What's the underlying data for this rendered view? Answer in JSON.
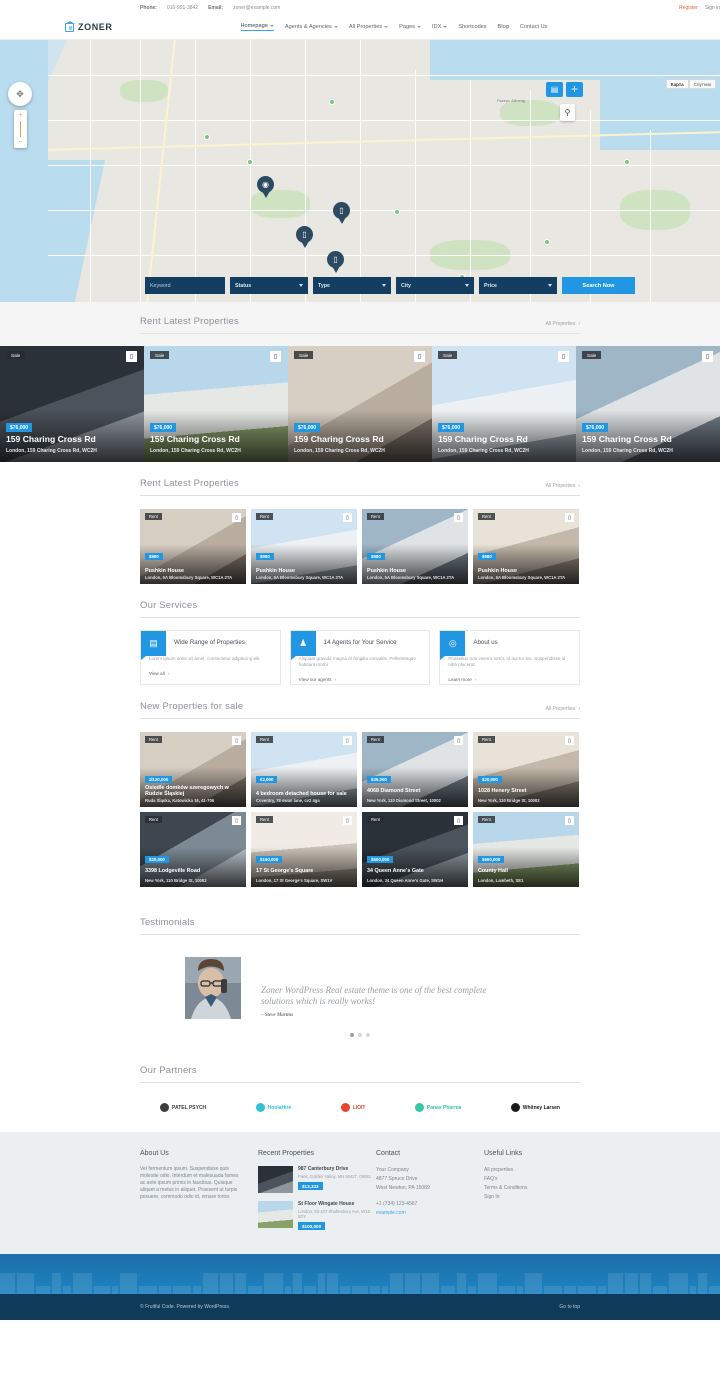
{
  "topbar": {
    "phone_label": "Phone:",
    "phone": "010-991-3842",
    "email_label": "Email:",
    "email": "zoner@example.com",
    "register": "Register",
    "signin": "Sign in"
  },
  "header": {
    "logo_text": "ZONER",
    "nav": [
      {
        "label": "Homepage",
        "has_caret": true,
        "active": true
      },
      {
        "label": "Agents & Agencies",
        "has_caret": true,
        "active": false
      },
      {
        "label": "All Properties",
        "has_caret": true,
        "active": false
      },
      {
        "label": "Pages",
        "has_caret": true,
        "active": false
      },
      {
        "label": "IDX",
        "has_caret": true,
        "active": false
      },
      {
        "label": "Shortcodes",
        "has_caret": false,
        "active": false
      },
      {
        "label": "Blog",
        "has_caret": false,
        "active": false
      },
      {
        "label": "Contact Us",
        "has_caret": false,
        "active": false
      }
    ]
  },
  "map": {
    "toggle_map": "Карта",
    "toggle_satellite": "Спутник",
    "label_island": "Рикерс Айленд",
    "zoom_in": "+",
    "zoom_out": "−"
  },
  "search": {
    "keyword_placeholder": "Keyword",
    "status": "Status",
    "type": "Type",
    "city": "City",
    "price": "Price",
    "button": "Search Now"
  },
  "section_rent_wide": {
    "title": "Rent Latest Properties",
    "link": "All Properties",
    "cards": [
      {
        "status": "Sale",
        "price": "$76,000",
        "title": "159 Charing Cross Rd",
        "address": "London, 159 Charing Cross Rd, WC2H"
      },
      {
        "status": "Sale",
        "price": "$76,000",
        "title": "159 Charing Cross Rd",
        "address": "London, 159 Charing Cross Rd, WC2H"
      },
      {
        "status": "Sale",
        "price": "$76,000",
        "title": "159 Charing Cross Rd",
        "address": "London, 159 Charing Cross Rd, WC2H"
      },
      {
        "status": "Sale",
        "price": "$76,000",
        "title": "159 Charing Cross Rd",
        "address": "London, 159 Charing Cross Rd, WC2H"
      },
      {
        "status": "Sale",
        "price": "$76,000",
        "title": "159 Charing Cross Rd",
        "address": "London, 159 Charing Cross Rd, WC2H"
      }
    ]
  },
  "section_rent_small": {
    "title": "Rent Latest Properties",
    "link": "All Properties",
    "cards": [
      {
        "status": "Rent",
        "price": "$980",
        "title": "Pushkin House",
        "address": "London, 5A Bloomsbury Square, WC1A 2TA"
      },
      {
        "status": "Rent",
        "price": "$980",
        "title": "Pushkin House",
        "address": "London, 5A Bloomsbury Square, WC1A 2TA"
      },
      {
        "status": "Rent",
        "price": "$980",
        "title": "Pushkin House",
        "address": "London, 5A Bloomsbury Square, WC1A 2TA"
      },
      {
        "status": "Rent",
        "price": "$980",
        "title": "Pushkin House",
        "address": "London, 5A Bloomsbury Square, WC1A 2TA"
      }
    ]
  },
  "services": {
    "title": "Our Services",
    "items": [
      {
        "icon": "briefcase-icon",
        "title": "Wide Range of Properties",
        "text": "Lorem ipsum dolor sit amet, consectetur adipiscing elit",
        "link": "View all"
      },
      {
        "icon": "agents-icon",
        "title": "14 Agents for Your Service",
        "text": "Aliquam gravida magna et fringilla convallis. Pellentesque habitant morbi",
        "link": "View our agents"
      },
      {
        "icon": "info-icon",
        "title": "About us",
        "text": "Phasellus non viverra tortor, id auctor leo. Suspendisse id nibh placerat.",
        "link": "Learn more"
      }
    ]
  },
  "section_new_sale": {
    "title": "New Properties for sale",
    "link": "All Properties",
    "cards": [
      {
        "status": "Rent",
        "price": "zł120,000",
        "title": "Osiedle domków szeregowych w Rudzie Śląskiej",
        "address": "Ruda Śląska, Katowicka 16, 41-706"
      },
      {
        "status": "Rent",
        "price": "€2,000",
        "title": "4 bedroom detached house for sale",
        "address": "Coventry, 78 swan lane, cv2 4ga"
      },
      {
        "status": "Rent",
        "price": "$35,000",
        "title": "4068 Diamond Street",
        "address": "New York, 110 Diamond Street, 10002"
      },
      {
        "status": "Rent",
        "price": "$20,000",
        "title": "1028 Henery Street",
        "address": "New York, 110 Bridge St, 10002"
      },
      {
        "status": "Rent",
        "price": "$20,000",
        "title": "3398 Lodgeville Road",
        "address": "New York, 110 Bridge St, 10002"
      },
      {
        "status": "Rent",
        "price": "$160,000",
        "title": "17 St George's Square",
        "address": "London, 17 St George's Square, SW1V"
      },
      {
        "status": "Rent",
        "price": "$500,000",
        "title": "34 Queen Anne's Gate",
        "address": "London, 34 Queen Anne's Gate, SW1H"
      },
      {
        "status": "Rent",
        "price": "$600,000",
        "title": "County Hall",
        "address": "London, Lambeth, SE1"
      }
    ]
  },
  "testimonials": {
    "title": "Testimonials",
    "quote": "Zoner WordPress Real estate theme is one of the best complete solutions which is really works!",
    "author": "– Steve Martins"
  },
  "partners": {
    "title": "Our Partners",
    "items": [
      {
        "name": "PATEL PSYCH",
        "color": "#3c3c3c"
      },
      {
        "name": "HoolaHire",
        "color": "#2ec4d6"
      },
      {
        "name": "LIOIT",
        "color": "#e8452c"
      },
      {
        "name": "Panax Pharma",
        "color": "#34c7a8"
      },
      {
        "name": "Whitney Larsen",
        "color": "#1a1a1a"
      }
    ]
  },
  "footer": {
    "about": {
      "title": "About Us",
      "text": "Vel fermentum ipsum. Suspendisse quis molestie odio. Interdum et malesuada fames ac ante ipsum primis in faucibus. Quisque aliquet a metus in aliquet. Praesent ut turpis posuere, commodo odio id, ornare tortor."
    },
    "recent": {
      "title": "Recent Properties",
      "items": [
        {
          "name": "987 Canterbury Drive",
          "address": "Paris, Golden Valley, MN 55427, 09081",
          "price": "$13,333"
        },
        {
          "name": "St Floor Wingate House",
          "address": "London, 93-107 Shaftesbury Ave, W1D 5DY",
          "price": "$100,000"
        }
      ]
    },
    "contact": {
      "title": "Contact",
      "company": "Your Company",
      "street": "4877 Spruce Drive",
      "city": "West Newton, PA 15089",
      "phone": "+1 (734) 123-4567",
      "email": "example.com"
    },
    "useful": {
      "title": "Useful Links",
      "links": [
        "All properties",
        "FAQ's",
        "Terms & Conditions",
        "Sign In"
      ]
    }
  },
  "bottombar": {
    "copyright": "© Fruitful Code. Powered by WordPress.",
    "gotop": "Go to top"
  }
}
